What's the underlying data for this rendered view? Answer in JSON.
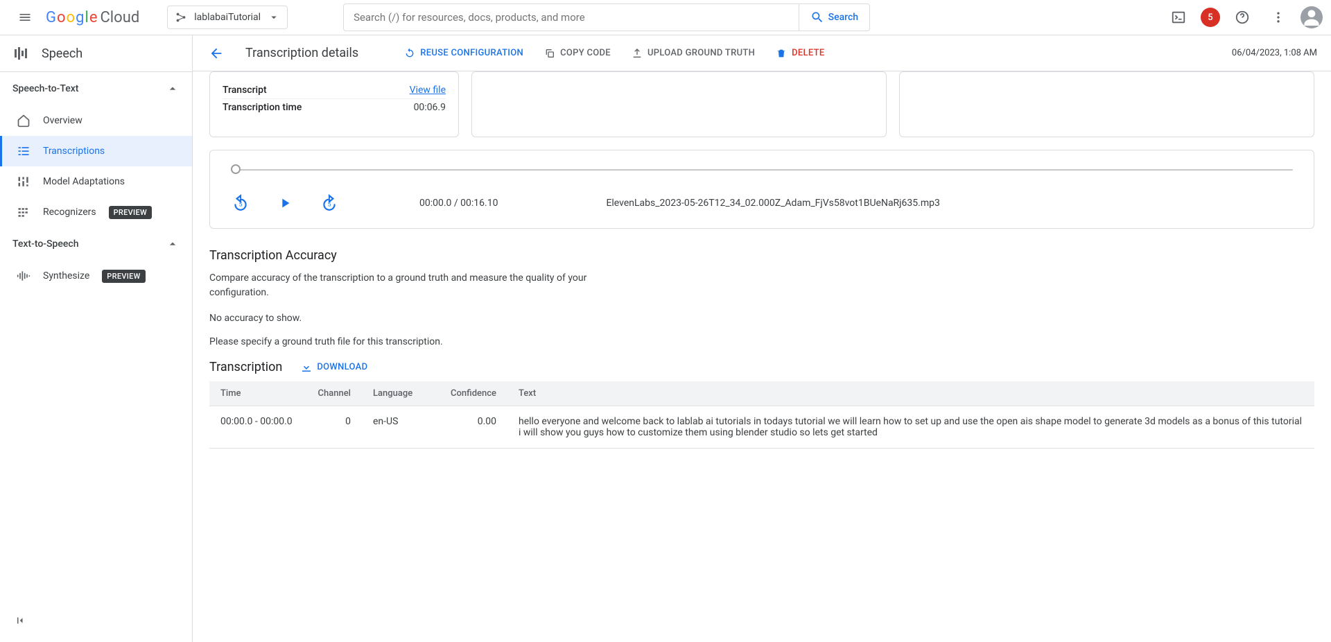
{
  "header": {
    "project": "lablabaiTutorial",
    "search_placeholder": "Search (/) for resources, docs, products, and more",
    "search_button": "Search",
    "notifications": "5"
  },
  "sidebar": {
    "product": "Speech",
    "section1": "Speech-to-Text",
    "items1": {
      "overview": "Overview",
      "transcriptions": "Transcriptions",
      "model_adaptations": "Model Adaptations",
      "recognizers": "Recognizers"
    },
    "section2": "Text-to-Speech",
    "items2": {
      "synthesize": "Synthesize"
    },
    "preview_badge": "PREVIEW"
  },
  "detail": {
    "title": "Transcription details",
    "reuse": "REUSE CONFIGURATION",
    "copy": "COPY CODE",
    "upload": "UPLOAD GROUND TRUTH",
    "delete": "DELETE",
    "timestamp": "06/04/2023, 1:08 AM"
  },
  "card1": {
    "transcript_label": "Transcript",
    "transcript_link": "View file",
    "time_label": "Transcription time",
    "time_value": "00:06.9"
  },
  "player": {
    "time": "00:00.0 / 00:16.10",
    "filename": "ElevenLabs_2023-05-26T12_34_02.000Z_Adam_FjVs58vot1BUeNaRj635.mp3"
  },
  "accuracy": {
    "title": "Transcription Accuracy",
    "desc": "Compare accuracy of the transcription to a ground truth and measure the quality of your configuration.",
    "empty": "No accuracy to show.",
    "hint": "Please specify a ground truth file for this transcription."
  },
  "transcription": {
    "title": "Transcription",
    "download": "DOWNLOAD",
    "headers": {
      "time": "Time",
      "channel": "Channel",
      "language": "Language",
      "confidence": "Confidence",
      "text": "Text"
    },
    "row": {
      "time": "00:00.0 - 00:00.0",
      "channel": "0",
      "language": "en-US",
      "confidence": "0.00",
      "text": "hello everyone and welcome back to lablab ai tutorials in todays tutorial we will learn how to set up and use the open ais shape model to generate 3d models as a bonus of this tutorial i will show you guys how to customize them using blender studio so lets get started"
    }
  }
}
